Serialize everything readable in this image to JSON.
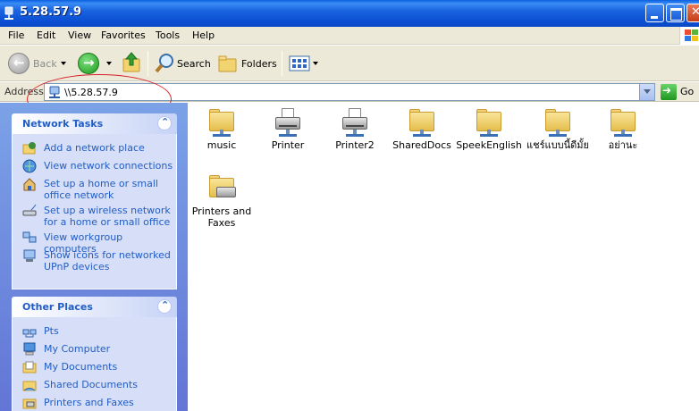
{
  "window": {
    "title": "5.28.57.9"
  },
  "menu": [
    "File",
    "Edit",
    "View",
    "Favorites",
    "Tools",
    "Help"
  ],
  "toolbar": {
    "back": "Back",
    "search": "Search",
    "folders": "Folders"
  },
  "address": {
    "label": "Address",
    "value": "\\\\5.28.57.9",
    "go": "Go"
  },
  "network_tasks": {
    "title": "Network Tasks",
    "items": [
      {
        "label": "Add a network place",
        "icon": "add-network-place-icon"
      },
      {
        "label": "View network connections",
        "icon": "network-connections-icon"
      },
      {
        "label": "Set up a home or small office network",
        "icon": "home-network-icon"
      },
      {
        "label": "Set up a wireless network for a home or small office",
        "icon": "wireless-network-icon"
      },
      {
        "label": "View workgroup computers",
        "icon": "workgroup-computers-icon"
      },
      {
        "label": "Show icons for networked UPnP devices",
        "icon": "upnp-devices-icon"
      }
    ]
  },
  "other_places": {
    "title": "Other Places",
    "items": [
      {
        "label": "Pts",
        "icon": "network-group-icon"
      },
      {
        "label": "My Computer",
        "icon": "my-computer-icon"
      },
      {
        "label": "My Documents",
        "icon": "my-documents-icon"
      },
      {
        "label": "Shared Documents",
        "icon": "shared-folder-icon"
      },
      {
        "label": "Printers and Faxes",
        "icon": "printers-faxes-icon"
      }
    ]
  },
  "shares": [
    {
      "label": "music",
      "type": "folder"
    },
    {
      "label": "Printer",
      "type": "printer"
    },
    {
      "label": "Printer2",
      "type": "printer"
    },
    {
      "label": "SharedDocs",
      "type": "folder"
    },
    {
      "label": "SpeekEnglish",
      "type": "folder"
    },
    {
      "label": "แชร์แบบนี้ดีมั้ย",
      "type": "folder"
    },
    {
      "label": "อย่านะ",
      "type": "folder"
    },
    {
      "label": "Printers and Faxes",
      "type": "printers-folder"
    }
  ],
  "colors": {
    "title_bar": "#0a5fe0",
    "task_pane": "#7ba2e7",
    "link_text": "#215dc6",
    "annotation_circle": "#d8202a"
  }
}
